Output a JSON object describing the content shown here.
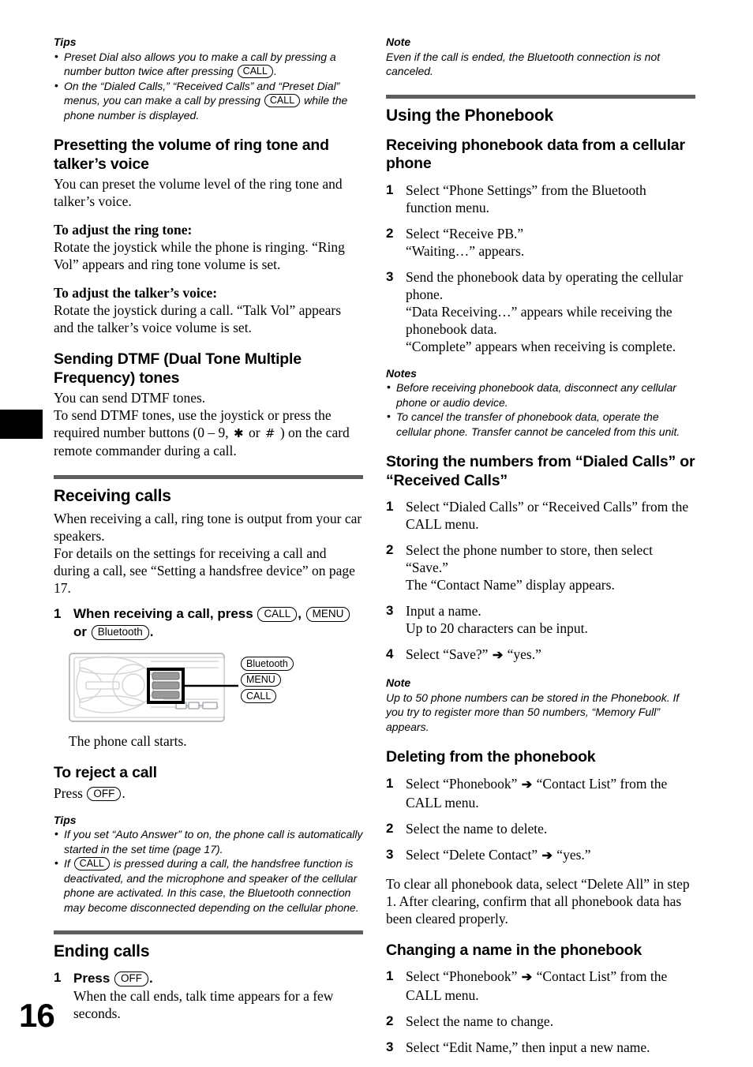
{
  "page": {
    "number": "16",
    "divider_color": "#5d5d5d"
  },
  "left_column": {
    "tips_top": {
      "title": "Tips",
      "items": [
        {
          "before": "Preset Dial also allows you to make a call by pressing a number button twice after pressing ",
          "pill": "CALL",
          "after": "."
        },
        {
          "before": "On the “Dialed Calls,” “Received Calls” and “Preset Dial” menus, you can make a call by pressing ",
          "pill": "CALL",
          "after": " while the phone number is displayed."
        }
      ]
    },
    "presetting_volume": {
      "heading": "Presetting the volume of ring tone and talker’s voice",
      "intro": "You can preset the volume level of the ring tone and talker’s voice.",
      "ring_tone_label": "To adjust the ring tone:",
      "ring_tone_text": "Rotate the joystick while the phone is ringing. “Ring Vol” appears and ring tone volume is set.",
      "talker_label": "To adjust the talker’s voice:",
      "talker_text": "Rotate the joystick during a call. “Talk Vol” appears and the talker’s voice volume is set."
    },
    "dtmf": {
      "heading": "Sending DTMF (Dual Tone Multiple Frequency) tones",
      "line1": "You can send DTMF tones.",
      "line2_part1": "To send DTMF tones, use the joystick or press the required number buttons (0 – 9, ",
      "star": "✱",
      "line2_part2": " or ",
      "hash": "#",
      "line2_part3": " ) on the card remote commander during a call."
    },
    "receiving_calls": {
      "heading": "Receiving calls",
      "intro1": "When receiving a call, ring tone is output from your car speakers.",
      "intro2": "For details on the settings for receiving a call and during a call, see “Setting a handsfree device” on page 17.",
      "step1": {
        "num": "1",
        "text_part1": "When receiving a call, press ",
        "pill1": "CALL",
        "text_part2": ", ",
        "pill2": "MENU",
        "text_part3": " or ",
        "pill3": "Bluetooth",
        "text_part4": "."
      },
      "diagram_callouts": [
        "Bluetooth",
        "MENU",
        "CALL"
      ],
      "caption": "The phone call starts."
    },
    "reject_call": {
      "heading": "To reject a call",
      "text_before": "Press ",
      "pill": "OFF",
      "text_after": "."
    },
    "tips_bottom": {
      "title": "Tips",
      "items": [
        {
          "before": "If you set “Auto Answer” to on, the phone call is automatically started in the set time (page 17).",
          "pill": "",
          "after": ""
        },
        {
          "before": "If ",
          "pill": "CALL",
          "after": " is pressed during a call, the handsfree function is deactivated, and the microphone and speaker of the cellular phone are activated. In this case, the Bluetooth connection may become disconnected depending on the cellular phone."
        }
      ]
    },
    "ending_calls": {
      "heading": "Ending calls",
      "step1": {
        "num": "1",
        "text_before": "Press ",
        "pill": "OFF",
        "text_after": "."
      },
      "step1_detail": "When the call ends, talk time appears for a few seconds."
    }
  },
  "right_column": {
    "note_top": {
      "title": "Note",
      "text": "Even if the call is ended, the Bluetooth connection is not canceled."
    },
    "using_phonebook": {
      "heading": "Using the Phonebook"
    },
    "receiving_phonebook": {
      "heading": "Receiving phonebook data from a cellular phone",
      "steps": [
        {
          "num": "1",
          "text": "Select “Phone Settings” from the Bluetooth function menu."
        },
        {
          "num": "2",
          "text": "Select “Receive PB.”\n“Waiting…” appears."
        },
        {
          "num": "3",
          "text": "Send the phonebook data by operating the cellular phone.\n“Data Receiving…” appears while receiving the phonebook data.\n“Complete” appears when receiving is complete."
        }
      ]
    },
    "notes_phonebook": {
      "title": "Notes",
      "items": [
        "Before receiving phonebook data, disconnect any cellular phone or audio device.",
        "To cancel the transfer of phonebook data, operate the cellular phone. Transfer cannot be canceled from this unit."
      ]
    },
    "storing_numbers": {
      "heading": "Storing the numbers from “Dialed Calls” or “Received Calls”",
      "steps": [
        {
          "num": "1",
          "text": "Select “Dialed Calls” or “Received Calls” from the CALL menu."
        },
        {
          "num": "2",
          "text": "Select the phone number to store, then select “Save.”\nThe “Contact Name” display appears."
        },
        {
          "num": "3",
          "text": "Input a name.\nUp to 20 characters can be input."
        }
      ],
      "step4": {
        "num": "4",
        "before": "Select “Save?” ",
        "arrow": "➔",
        "after": " “yes.”"
      }
    },
    "note_memory": {
      "title": "Note",
      "text": "Up to 50 phone numbers can be stored in the Phonebook. If you try to register more than 50 numbers, “Memory Full” appears."
    },
    "deleting_phonebook": {
      "heading": "Deleting from the phonebook",
      "step1": {
        "num": "1",
        "before": "Select “Phonebook” ",
        "arrow": "➔",
        "after": " “Contact List” from the CALL menu."
      },
      "step2": {
        "num": "2",
        "text": "Select the name to delete."
      },
      "step3": {
        "num": "3",
        "before": "Select “Delete Contact” ",
        "arrow": "➔",
        "after": " “yes.”"
      },
      "trailing": "To clear all phonebook data, select “Delete All” in step 1. After clearing, confirm that all phonebook data has been cleared properly."
    },
    "changing_name": {
      "heading": "Changing a name in the phonebook",
      "step1": {
        "num": "1",
        "before": "Select “Phonebook” ",
        "arrow": "➔",
        "after": " “Contact List” from the CALL menu."
      },
      "step2": {
        "num": "2",
        "text": "Select the name to change."
      },
      "step3": {
        "num": "3",
        "text": "Select “Edit Name,” then input a new name."
      }
    }
  }
}
